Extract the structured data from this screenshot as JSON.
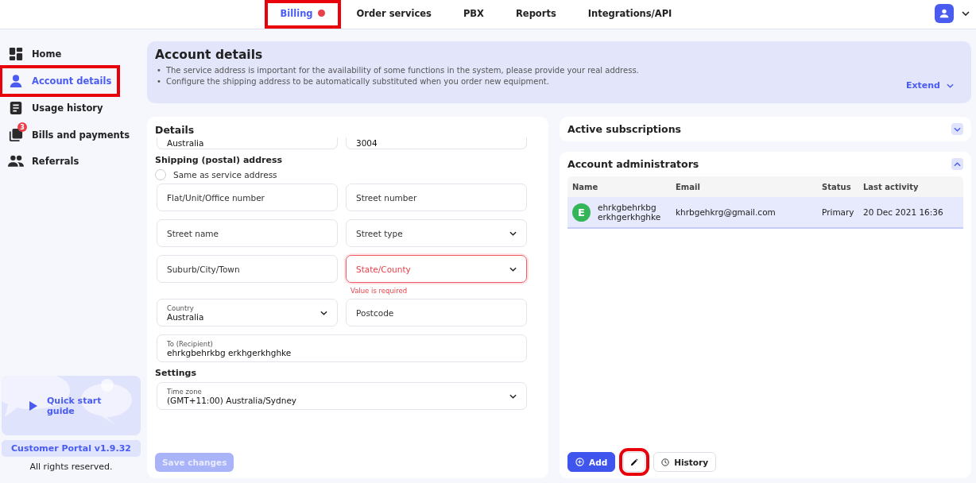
{
  "top_tabs": [
    {
      "label": "Billing",
      "selected": true,
      "dot": true,
      "highlighted": true
    },
    {
      "label": "Order services",
      "selected": false,
      "dot": false,
      "highlighted": false
    },
    {
      "label": "PBX",
      "selected": false,
      "dot": false,
      "highlighted": false
    },
    {
      "label": "Reports",
      "selected": false,
      "dot": false,
      "highlighted": false
    },
    {
      "label": "Integrations/API",
      "selected": false,
      "dot": false,
      "highlighted": false
    }
  ],
  "sidebar": {
    "items": [
      {
        "label": "Home",
        "selected": false,
        "highlighted": false
      },
      {
        "label": "Account details",
        "selected": true,
        "highlighted": true
      },
      {
        "label": "Usage history",
        "selected": false,
        "highlighted": false
      },
      {
        "label": "Bills and payments",
        "selected": false,
        "highlighted": false,
        "badge": "3"
      },
      {
        "label": "Referrals",
        "selected": false,
        "highlighted": false
      }
    ],
    "quick_start": "Quick start guide",
    "version": "Customer Portal v1.9.32",
    "copyright": "All rights reserved."
  },
  "header": {
    "title": "Account details",
    "notes": [
      {
        "bullet": "•",
        "text": "The service address is important for the availability of some functions in the system, please provide your real address."
      },
      {
        "bullet": "•",
        "text": "Configure the shipping address to be automatically substituted when you order new equipment."
      }
    ],
    "extend": "Extend"
  },
  "details": {
    "title": "Details",
    "scrolled_values": [
      "Australia",
      "3004"
    ],
    "shipping_title": "Shipping (postal) address",
    "same_as_service": {
      "label": "Same as service address",
      "checked": false
    },
    "fields": [
      {
        "kind": "text",
        "placeholder": "Flat/Unit/Office number",
        "error": false,
        "wide": false
      },
      {
        "kind": "text",
        "placeholder": "Street number",
        "error": false,
        "wide": false
      },
      {
        "kind": "text",
        "placeholder": "Street name",
        "error": false,
        "wide": false
      },
      {
        "kind": "select",
        "placeholder": "Street type",
        "error": false,
        "wide": false
      },
      {
        "kind": "text",
        "placeholder": "Suburb/City/Town",
        "error": false,
        "wide": false
      },
      {
        "kind": "select",
        "placeholder": "State/County",
        "error": true,
        "error_text": "Value is required",
        "wide": false
      },
      {
        "kind": "select",
        "label": "Country",
        "value": "Australia",
        "error": false,
        "wide": false
      },
      {
        "kind": "text",
        "placeholder": "Postcode",
        "error": false,
        "wide": false
      },
      {
        "kind": "text",
        "label": "To (Recipient)",
        "value": "ehrkgbehrkbg erkhgerkhghke",
        "error": false,
        "wide": true
      }
    ],
    "settings_title": "Settings",
    "settings_fields": [
      {
        "kind": "select",
        "label": "Time zone",
        "value": "(GMT+11:00) Australia/Sydney",
        "error": false,
        "wide": true
      }
    ],
    "save": {
      "label": "Save changes",
      "disabled": true
    }
  },
  "panels": [
    {
      "title": "Active subscriptions",
      "expanded": false
    },
    {
      "title": "Account administrators",
      "expanded": true
    }
  ],
  "admins": {
    "columns": [
      "Name",
      "Email",
      "Status",
      "Last activity"
    ],
    "rows": [
      {
        "initial": "E",
        "color": "#34b55a",
        "name": "ehrkgbehrkbg erkhgerkhghke",
        "email": "khrbgehkrg@gmail.com",
        "status": "Primary",
        "last_activity": "20 Dec 2021 16:36",
        "selected": true
      }
    ],
    "buttons": [
      {
        "kind": "add",
        "label": "Add",
        "highlighted": false
      },
      {
        "kind": "edit",
        "highlighted": true
      },
      {
        "kind": "history",
        "label": "History",
        "highlighted": false
      }
    ]
  }
}
